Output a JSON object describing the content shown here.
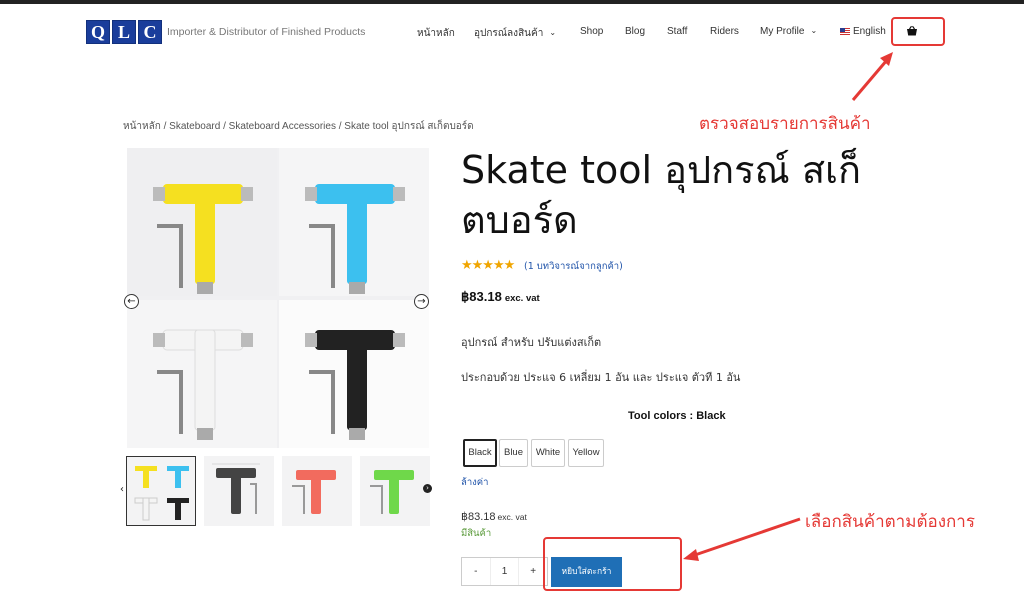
{
  "header": {
    "logo_letters": [
      "Q",
      "L",
      "C"
    ],
    "tagline": "Importer & Distributor of Finished Products",
    "nav": [
      {
        "label": "หน้าหลัก",
        "has_dropdown": false
      },
      {
        "label": "อุปกรณ์ลงสินค้า",
        "has_dropdown": true
      },
      {
        "label": "Shop",
        "has_dropdown": false
      },
      {
        "label": "Blog",
        "has_dropdown": false
      },
      {
        "label": "Staff",
        "has_dropdown": false
      },
      {
        "label": "Riders",
        "has_dropdown": false
      },
      {
        "label": "My Profile",
        "has_dropdown": true
      },
      {
        "label": "English",
        "has_dropdown": false
      }
    ],
    "cart_icon": "shopping-basket-icon"
  },
  "annotations": {
    "cart_note": "ตรวจสอบรายการสินค้า",
    "select_note": "เลือกสินค้าตามต้องการ",
    "color": "#e53935"
  },
  "breadcrumb": {
    "items": [
      "หน้าหลัก",
      "Skateboard",
      "Skateboard Accessories",
      "Skate tool อุปกรณ์ สเก็ตบอร์ด"
    ],
    "separator": " / "
  },
  "gallery": {
    "tool_colors": [
      "#f5e020",
      "#3cc0ef",
      "#f4f4f4",
      "#222222"
    ],
    "thumb_colors": [
      [
        "#f5e020",
        "#3cc0ef",
        "#f4f4f4",
        "#222222"
      ],
      [
        "#444444"
      ],
      [
        "#f26b5e"
      ],
      [
        "#6fd84a"
      ]
    ],
    "prev_icon": "arrow-left-icon",
    "next_icon": "arrow-right-icon"
  },
  "product": {
    "title": "Skate tool อุปกรณ์ สเก็ตบอร์ด",
    "rating": 5,
    "stars": "★★★★★",
    "reviews": "(1 บทวิจารณ์จากลูกค้า)",
    "price": "฿83.18",
    "price_suffix": "exc. vat",
    "description_1": "อุปกรณ์ สำหรับ ปรับแต่งสเก็ต",
    "description_2": "ประกอบด้วย ประแจ 6 เหลี่ยม 1 อัน และ ประแจ ตัวที 1 อัน",
    "colors_label": "Tool colors : Black",
    "color_options": [
      "Black",
      "Blue",
      "White",
      "Yellow"
    ],
    "selected_color": "Black",
    "clear_label": "ล้างค่า",
    "variation_price": "฿83.18",
    "variation_price_suffix": "exc. vat",
    "stock": "มีสินค้า",
    "quantity": "1",
    "minus": "-",
    "plus": "+",
    "add_to_cart": "หยิบใส่ตะกร้า"
  },
  "colors": {
    "accent": "#1f6fb6",
    "logo": "#1a3d9b",
    "stars": "#f0a500",
    "stock": "#5a9a3a"
  }
}
